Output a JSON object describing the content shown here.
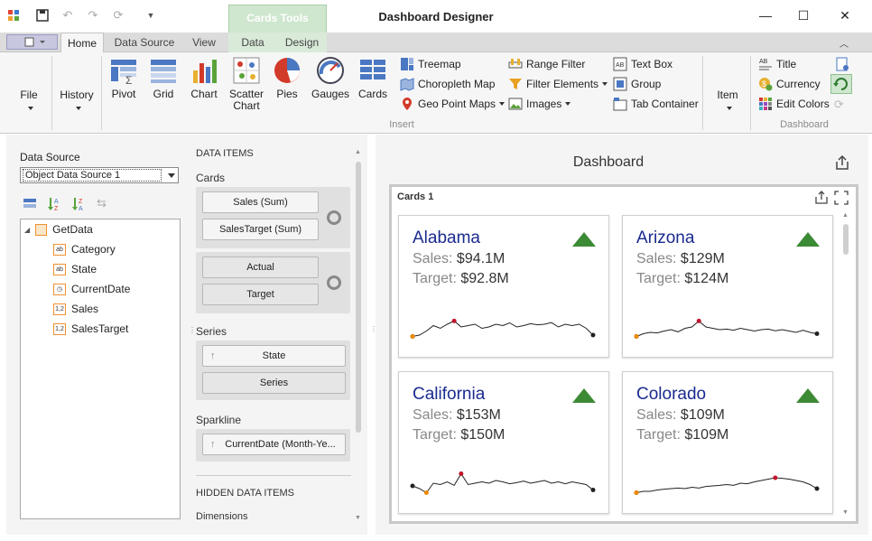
{
  "app": {
    "title": "Dashboard Designer",
    "context_tab": "Cards Tools"
  },
  "tabs": [
    "Home",
    "Data Source",
    "View",
    "Data",
    "Design"
  ],
  "ribbon": {
    "file": "File",
    "history": "History",
    "big": [
      "Pivot",
      "Grid",
      "Chart",
      "Scatter Chart",
      "Pies",
      "Gauges",
      "Cards"
    ],
    "col1": [
      "Treemap",
      "Choropleth Map",
      "Geo Point Maps"
    ],
    "col2": [
      "Range Filter",
      "Filter Elements",
      "Images"
    ],
    "col3": [
      "Text Box",
      "Group",
      "Tab Container"
    ],
    "item": "Item",
    "dash": [
      "Title",
      "Currency",
      "Edit Colors"
    ],
    "group_insert": "Insert",
    "group_dashboard": "Dashboard"
  },
  "left": {
    "data_source_label": "Data Source",
    "data_source_value": "Object Data Source 1",
    "root": "GetData",
    "fields": [
      {
        "name": "Category",
        "type": "ab"
      },
      {
        "name": "State",
        "type": "ab"
      },
      {
        "name": "CurrentDate",
        "type": "clock"
      },
      {
        "name": "Sales",
        "type": "1,2"
      },
      {
        "name": "SalesTarget",
        "type": "1,2"
      }
    ]
  },
  "mid": {
    "data_items": "DATA ITEMS",
    "cards": "Cards",
    "card_measures": [
      "Sales (Sum)",
      "SalesTarget (Sum)"
    ],
    "card_actual": "Actual",
    "card_target": "Target",
    "series_label": "Series",
    "series_state": "State",
    "series_placeholder": "Series",
    "sparkline_label": "Sparkline",
    "sparkline_item": "CurrentDate (Month-Ye...",
    "hidden": "HIDDEN DATA ITEMS",
    "dimensions": "Dimensions"
  },
  "dashboard": {
    "title": "Dashboard",
    "item_caption": "Cards 1",
    "sales_label": "Sales:",
    "target_label": "Target:",
    "cards": [
      {
        "state": "Alabama",
        "sales": "$94.1M",
        "target": "$92.8M",
        "spark": [
          0.15,
          0.2,
          0.35,
          0.55,
          0.45,
          0.6,
          0.72,
          0.5,
          0.55,
          0.6,
          0.45,
          0.5,
          0.6,
          0.55,
          0.65,
          0.5,
          0.55,
          0.62,
          0.58,
          0.6,
          0.66,
          0.5,
          0.6,
          0.55,
          0.6,
          0.45,
          0.2
        ]
      },
      {
        "state": "Arizona",
        "sales": "$129M",
        "target": "$124M",
        "spark": [
          0.15,
          0.25,
          0.3,
          0.28,
          0.35,
          0.4,
          0.32,
          0.45,
          0.5,
          0.72,
          0.5,
          0.45,
          0.4,
          0.42,
          0.38,
          0.45,
          0.4,
          0.35,
          0.4,
          0.42,
          0.36,
          0.4,
          0.35,
          0.3,
          0.38,
          0.3,
          0.25
        ]
      },
      {
        "state": "California",
        "sales": "$153M",
        "target": "$150M",
        "spark": [
          0.4,
          0.3,
          0.15,
          0.5,
          0.45,
          0.55,
          0.42,
          0.85,
          0.45,
          0.5,
          0.55,
          0.5,
          0.6,
          0.55,
          0.48,
          0.52,
          0.58,
          0.5,
          0.55,
          0.6,
          0.5,
          0.55,
          0.48,
          0.55,
          0.5,
          0.45,
          0.25
        ]
      },
      {
        "state": "Colorado",
        "sales": "$109M",
        "target": "$109M",
        "spark": [
          0.15,
          0.2,
          0.2,
          0.25,
          0.28,
          0.3,
          0.32,
          0.3,
          0.35,
          0.32,
          0.38,
          0.4,
          0.42,
          0.45,
          0.42,
          0.5,
          0.48,
          0.55,
          0.6,
          0.65,
          0.7,
          0.68,
          0.65,
          0.6,
          0.55,
          0.45,
          0.3
        ]
      }
    ]
  }
}
